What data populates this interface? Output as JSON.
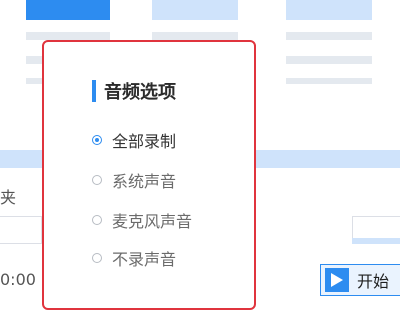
{
  "audio_panel": {
    "title": "音频选项",
    "options": [
      {
        "label": "全部录制",
        "checked": true
      },
      {
        "label": "系统声音",
        "checked": false
      },
      {
        "label": "麦克风声音",
        "checked": false
      },
      {
        "label": "不录声音",
        "checked": false
      }
    ]
  },
  "left_panel": {
    "folder_label_fragment": "夹",
    "timer_fragment": "0:00"
  },
  "start_button": {
    "label": "开始",
    "icon": "play-icon"
  },
  "colors": {
    "accent": "#2d8cf0",
    "highlight_border": "#e0343d"
  }
}
